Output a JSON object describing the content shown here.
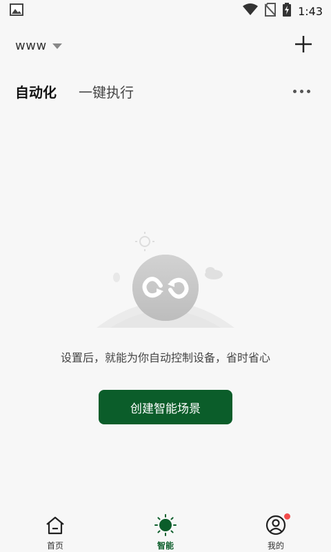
{
  "status_bar": {
    "time": "1:43",
    "icons": [
      "image-icon",
      "wifi-icon",
      "no-sim-icon",
      "battery-charging-icon"
    ]
  },
  "header": {
    "home_name": "www",
    "dropdown_icon": "caret-down-icon",
    "add_icon": "plus-icon"
  },
  "tabs": [
    {
      "label": "自动化",
      "active": true
    },
    {
      "label": "一键执行",
      "active": false
    }
  ],
  "more_icon": "more-horizontal-icon",
  "empty_state": {
    "illustration": "automation-loop-icon",
    "message": "设置后，就能为你自动控制设备，省时省心",
    "button_label": "创建智能场景"
  },
  "bottom_nav": [
    {
      "label": "首页",
      "icon": "home-icon",
      "active": false
    },
    {
      "label": "智能",
      "icon": "smart-sun-icon",
      "active": true
    },
    {
      "label": "我的",
      "icon": "user-icon",
      "active": false,
      "badge": true
    }
  ],
  "colors": {
    "accent": "#0b5d2a",
    "background": "#f7f7f7",
    "badge": "#f24b4b"
  }
}
